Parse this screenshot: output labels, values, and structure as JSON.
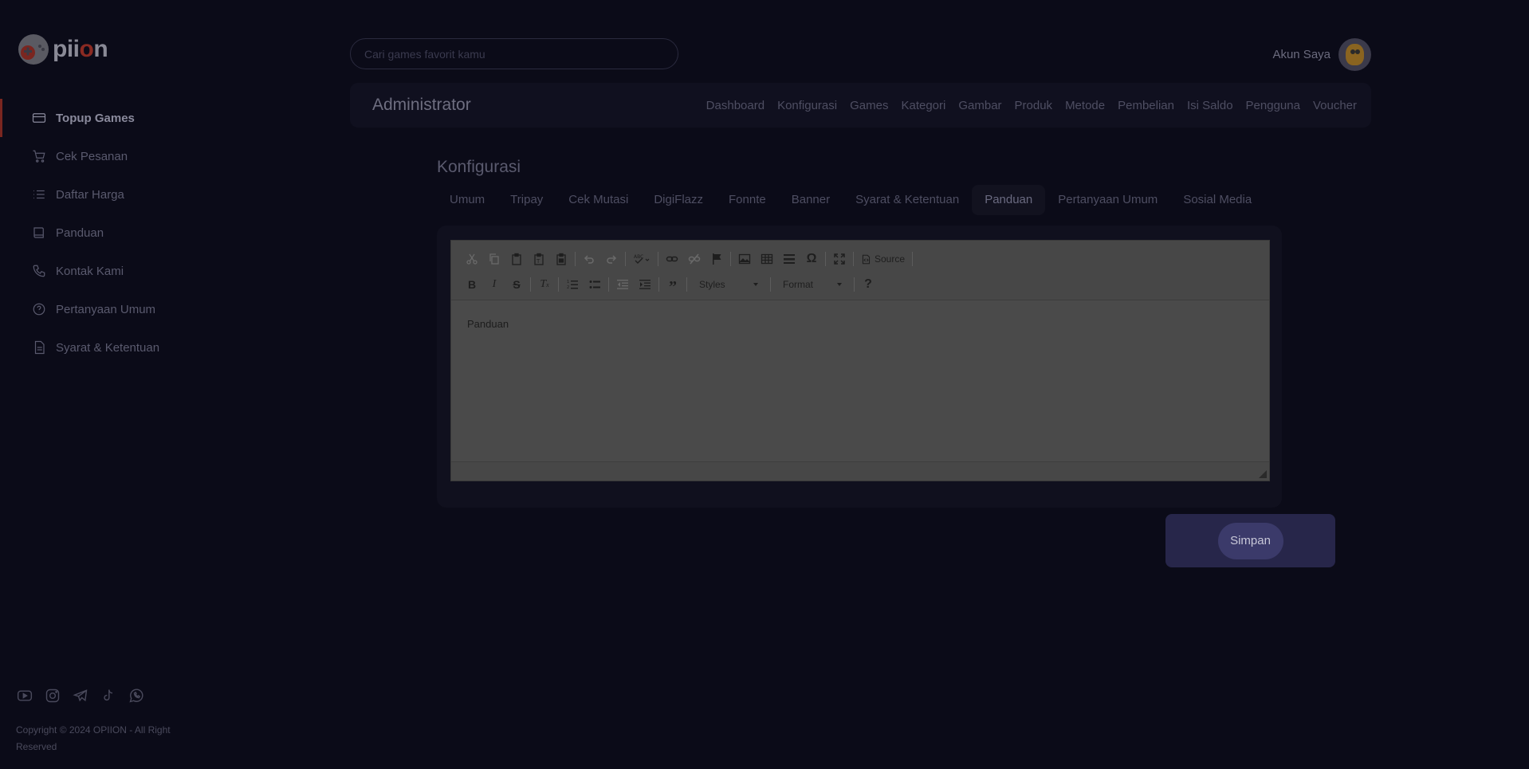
{
  "brand": {
    "logo_text_prefix": "pii",
    "logo_text_o": "o",
    "logo_text_suffix": "n"
  },
  "sidebar": {
    "items": [
      {
        "label": "Topup Games",
        "icon": "card-icon",
        "active": true
      },
      {
        "label": "Cek Pesanan",
        "icon": "cart-icon",
        "active": false
      },
      {
        "label": "Daftar Harga",
        "icon": "list-icon",
        "active": false
      },
      {
        "label": "Panduan",
        "icon": "book-icon",
        "active": false
      },
      {
        "label": "Kontak Kami",
        "icon": "phone-icon",
        "active": false
      },
      {
        "label": "Pertanyaan Umum",
        "icon": "help-circle-icon",
        "active": false
      },
      {
        "label": "Syarat & Ketentuan",
        "icon": "document-icon",
        "active": false
      }
    ],
    "socials": [
      "youtube-icon",
      "instagram-icon",
      "telegram-icon",
      "tiktok-icon",
      "whatsapp-icon"
    ],
    "copyright": "Copyright © 2024 OPIION - All Right Reserved"
  },
  "header": {
    "search_placeholder": "Cari games favorit kamu",
    "account_label": "Akun Saya"
  },
  "admin_bar": {
    "title": "Administrator",
    "links": [
      "Dashboard",
      "Konfigurasi",
      "Games",
      "Kategori",
      "Gambar",
      "Produk",
      "Metode",
      "Pembelian",
      "Isi Saldo",
      "Pengguna",
      "Voucher"
    ]
  },
  "main": {
    "section_title": "Konfigurasi",
    "tabs": [
      "Umum",
      "Tripay",
      "Cek Mutasi",
      "DigiFlazz",
      "Fonnte",
      "Banner",
      "Syarat & Ketentuan",
      "Panduan",
      "Pertanyaan Umum",
      "Sosial Media"
    ],
    "active_tab": "Panduan",
    "editor": {
      "source_label": "Source",
      "styles_label": "Styles",
      "format_label": "Format",
      "help_label": "?",
      "content": "Panduan"
    },
    "save_label": "Simpan"
  },
  "colors": {
    "background": "#0b0b18",
    "accent": "#7a2620",
    "save_button": "#3b3a6a"
  }
}
